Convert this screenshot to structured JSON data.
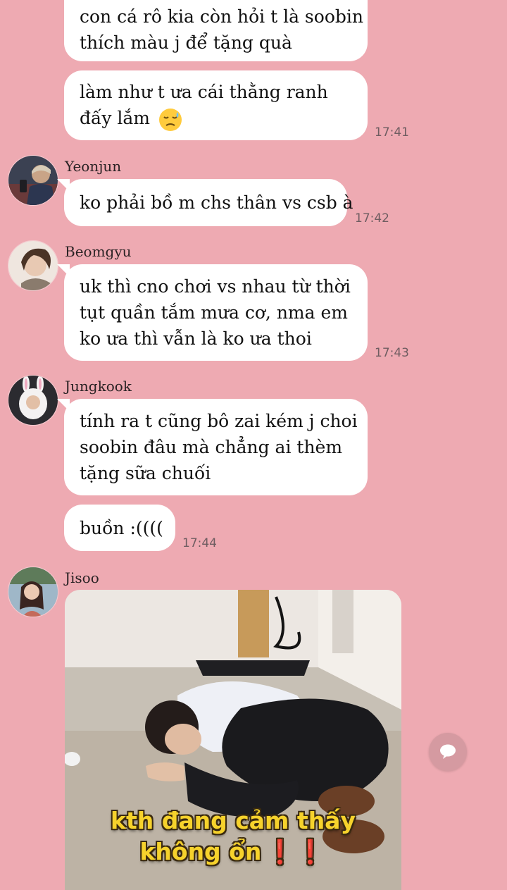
{
  "messages": [
    {
      "lines": [
        "con cá rô kia còn hỏi t là soobin",
        "thích màu j để tặng quà"
      ]
    },
    {
      "lines": [
        "làm như t ưa cái thằng ranh",
        "đấy lắm"
      ],
      "emoji": "sad-face-emoji",
      "time": "17:41"
    },
    {
      "sender": "Yeonjun",
      "lines": [
        "ko phải bồ m chs thân vs csb à"
      ],
      "time": "17:42"
    },
    {
      "sender": "Beomgyu",
      "lines": [
        "uk thì cno chơi vs nhau từ thời",
        "tụt quần tắm mưa cơ, nma em",
        "ko ưa thì vẫn là ko ưa thoi"
      ],
      "time": "17:43"
    },
    {
      "sender": "Jungkook",
      "lines": [
        "tính ra t cũng bô zai kém j choi",
        "soobin đâu mà chẳng ai thèm",
        "tặng sữa chuối"
      ]
    },
    {
      "lines": [
        "buồn :(((("
      ],
      "time": "17:44"
    },
    {
      "sender": "Jisoo",
      "image_caption": [
        "kth đang cảm thấy",
        "không ổn"
      ],
      "caption_marks": "❗❗"
    }
  ],
  "colors": {
    "background": "#eeaab2",
    "bubble": "#ffffff",
    "caption": "#f6d22c"
  },
  "icons": {
    "floating_button": "chat-bubble-icon"
  }
}
